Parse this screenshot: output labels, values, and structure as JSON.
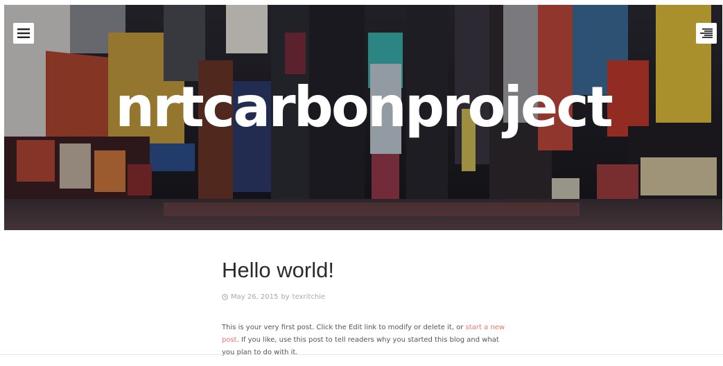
{
  "header": {
    "site_title": "nrtcarbonproject",
    "menu_icon": "hamburger-menu-icon",
    "sidebar_icon": "align-right-lines-icon"
  },
  "post": {
    "title": "Hello world!",
    "date": "May 26, 2015",
    "by": "by",
    "author": "texritchie",
    "body_before_link": "This is your very first post. Click the Edit link to modify or delete it, or ",
    "link_text": "start a new post",
    "body_after_link": ". If you like, use this post to tell readers why you started this blog and what you plan to do with it."
  },
  "colors": {
    "link": "#e8776b",
    "title": "#2b2b2b",
    "meta": "#a8a8a8"
  }
}
